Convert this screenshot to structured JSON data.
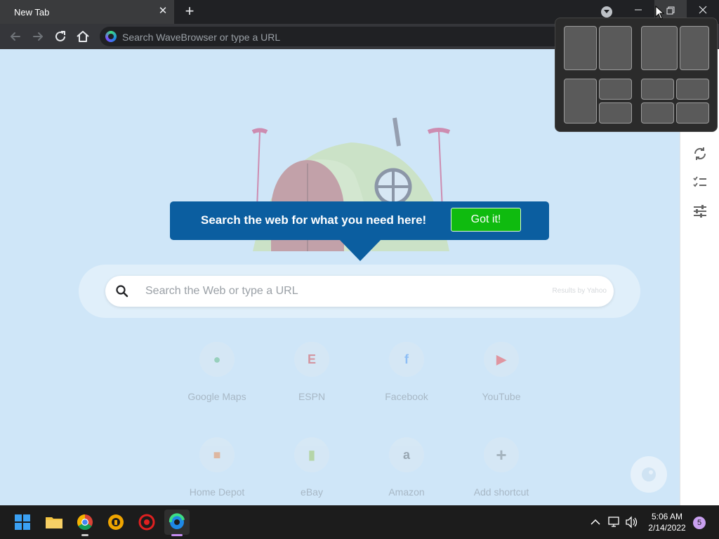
{
  "browser": {
    "tab_title": "New Tab",
    "omnibox_placeholder": "Search WaveBrowser or type a URL"
  },
  "page": {
    "callout_text": "Search the web for what you need here!",
    "callout_button": "Got it!",
    "search_placeholder": "Search the Web or type a URL",
    "results_by": "Results by Yahoo",
    "shortcuts": [
      {
        "label": "Google Maps",
        "icon": "google-maps-icon"
      },
      {
        "label": "ESPN",
        "icon": "espn-icon"
      },
      {
        "label": "Facebook",
        "icon": "facebook-icon"
      },
      {
        "label": "YouTube",
        "icon": "youtube-icon"
      },
      {
        "label": "Home Depot",
        "icon": "home-depot-icon"
      },
      {
        "label": "eBay",
        "icon": "ebay-icon"
      },
      {
        "label": "Amazon",
        "icon": "amazon-icon"
      },
      {
        "label": "Add shortcut",
        "icon": "plus-icon"
      }
    ]
  },
  "taskbar": {
    "time": "5:06 AM",
    "date": "2/14/2022",
    "notification_count": "5"
  },
  "colors": {
    "callout_bg": "#0b5ea0",
    "gotit_bg": "#0fbb0f",
    "page_bg": "#cfe6f8"
  }
}
